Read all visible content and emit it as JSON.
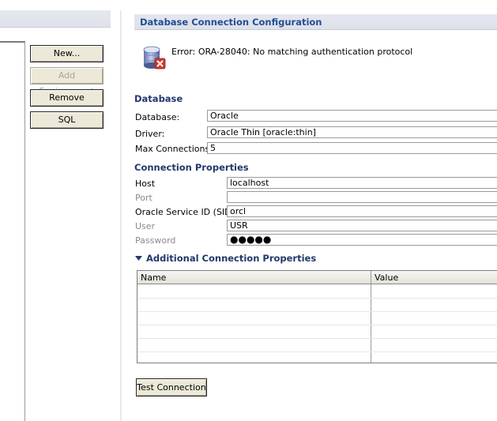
{
  "left_panel": {
    "buttons": {
      "new": "New...",
      "add_environment": "Add Environment",
      "remove": "Remove",
      "sql": "SQL"
    }
  },
  "config": {
    "title": "Database Connection Configuration",
    "error_message": "Error: ORA-28040: No matching authentication protocol",
    "database_section": {
      "title": "Database",
      "database_label": "Database:",
      "database_value": "Oracle",
      "driver_label": "Driver:",
      "driver_value": "Oracle Thin [oracle:thin]",
      "max_connections_label": "Max Connections:",
      "max_connections_value": "5"
    },
    "connection_section": {
      "title": "Connection Properties",
      "host_label": "Host",
      "host_value": "localhost",
      "port_label": "Port",
      "port_value": "",
      "sid_label": "Oracle Service ID (SID)",
      "sid_value": "orcl",
      "user_label": "User",
      "user_value": "USR",
      "password_label": "Password",
      "password_value": "●●●●●"
    },
    "additional_section": {
      "title": "Additional Connection Properties",
      "columns": [
        "Name",
        "Value"
      ]
    },
    "test_button": "Test Connection"
  },
  "colors": {
    "section_title": "#22386b",
    "header_title": "#254d92",
    "error_icon": "#d23a2a"
  },
  "icons": {
    "database_error": "database-error-icon",
    "expand": "triangle-down-icon"
  }
}
